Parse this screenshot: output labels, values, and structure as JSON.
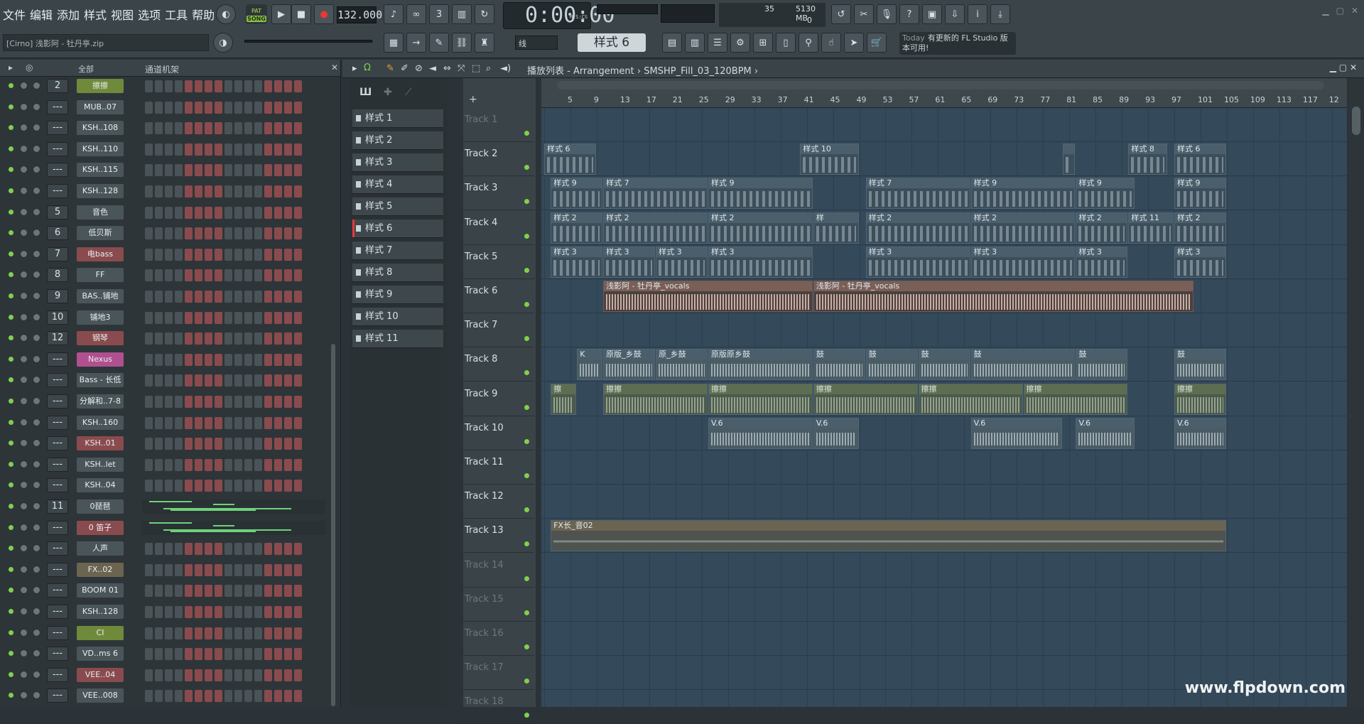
{
  "menu": [
    "文件",
    "编辑",
    "添加",
    "样式",
    "视图",
    "选项",
    "工具",
    "帮助"
  ],
  "transport": {
    "mode_top": "PAT",
    "mode_label": "SONG",
    "tempo": "132.000",
    "time": "0:00:00",
    "time_unit": "M:S:CS"
  },
  "cpu": {
    "value": "35",
    "memory": "5130 MB",
    "poly": "0"
  },
  "project": "[Cirno] 浅影阿 - 牡丹亭.zip",
  "toolbar2": {
    "mode": "线",
    "pattern": "样式 6",
    "news_day": "Today",
    "news_text": "有更新的 FL Studio 版本可用!"
  },
  "rack": {
    "filter": "全部",
    "title": "通道机架"
  },
  "channels": [
    {
      "num": "2",
      "name": "擦擦",
      "color": "#6f8a3a",
      "type": "steps"
    },
    {
      "num": "---",
      "name": "MUB..07",
      "color": "#4a555a",
      "type": "steps"
    },
    {
      "num": "---",
      "name": "KSH..108",
      "color": "#4a555a",
      "type": "steps"
    },
    {
      "num": "---",
      "name": "KSH..110",
      "color": "#4a555a",
      "type": "steps"
    },
    {
      "num": "---",
      "name": "KSH..115",
      "color": "#4a555a",
      "type": "steps"
    },
    {
      "num": "---",
      "name": "KSH..128",
      "color": "#4a555a",
      "type": "steps"
    },
    {
      "num": "5",
      "name": "音色",
      "color": "#4a555a",
      "type": "steps"
    },
    {
      "num": "6",
      "name": "低贝斯",
      "color": "#4a555a",
      "type": "steps"
    },
    {
      "num": "7",
      "name": "电bass",
      "color": "#8a4b4e",
      "type": "steps"
    },
    {
      "num": "8",
      "name": "FF",
      "color": "#4a555a",
      "type": "steps"
    },
    {
      "num": "9",
      "name": "BAS..铺地",
      "color": "#4a555a",
      "type": "steps"
    },
    {
      "num": "10",
      "name": "铺地3",
      "color": "#4a555a",
      "type": "steps"
    },
    {
      "num": "12",
      "name": "钢琴",
      "color": "#8a4b4e",
      "type": "steps"
    },
    {
      "num": "---",
      "name": "Nexus",
      "color": "#b0508f",
      "type": "steps"
    },
    {
      "num": "---",
      "name": "Bass - 长低",
      "color": "#4a555a",
      "type": "steps"
    },
    {
      "num": "---",
      "name": "分解和..7-8",
      "color": "#4a555a",
      "type": "steps"
    },
    {
      "num": "---",
      "name": "KSH..160",
      "color": "#4a555a",
      "type": "steps"
    },
    {
      "num": "---",
      "name": "KSH..01",
      "color": "#8a4b4e",
      "type": "steps"
    },
    {
      "num": "---",
      "name": "KSH..let",
      "color": "#4a555a",
      "type": "steps"
    },
    {
      "num": "---",
      "name": "KSH..04",
      "color": "#4a555a",
      "type": "steps"
    },
    {
      "num": "11",
      "name": "0琵琶",
      "color": "#4a555a",
      "type": "graph"
    },
    {
      "num": "---",
      "name": "0 笛子",
      "color": "#8a4b4e",
      "type": "graph"
    },
    {
      "num": "---",
      "name": "人声",
      "color": "#4a555a",
      "type": "steps"
    },
    {
      "num": "---",
      "name": "FX..02",
      "color": "#6b6450",
      "type": "steps"
    },
    {
      "num": "---",
      "name": "BOOM 01",
      "color": "#4a555a",
      "type": "steps"
    },
    {
      "num": "---",
      "name": "KSH..128",
      "color": "#4a555a",
      "type": "steps"
    },
    {
      "num": "---",
      "name": "CI",
      "color": "#6f8a3a",
      "type": "steps"
    },
    {
      "num": "---",
      "name": "VD..ms 6",
      "color": "#4a555a",
      "type": "steps"
    },
    {
      "num": "---",
      "name": "VEE..04",
      "color": "#8a4b4e",
      "type": "steps"
    },
    {
      "num": "---",
      "name": "VEE..008",
      "color": "#4a555a",
      "type": "steps"
    }
  ],
  "patterns": [
    "样式 1",
    "样式 2",
    "样式 3",
    "样式 4",
    "样式 5",
    "样式 6",
    "样式 7",
    "样式 8",
    "样式 9",
    "样式 10",
    "样式 11"
  ],
  "playlist": {
    "title": "播放列表 - Arrangement",
    "sample": "SMSHP_Fill_03_120BPM"
  },
  "ruler": [
    "5",
    "9",
    "13",
    "17",
    "21",
    "25",
    "29",
    "33",
    "37",
    "41",
    "45",
    "49",
    "53",
    "57",
    "61",
    "65",
    "69",
    "73",
    "77",
    "81",
    "85",
    "89",
    "93",
    "97",
    "101",
    "105",
    "109",
    "113",
    "117",
    "12"
  ],
  "tracks": [
    "Track 1",
    "Track 2",
    "Track 3",
    "Track 4",
    "Track 5",
    "Track 6",
    "Track 7",
    "Track 8",
    "Track 9",
    "Track 10",
    "Track 11",
    "Track 12",
    "Track 13",
    "Track 14",
    "Track 15",
    "Track 16",
    "Track 17",
    "Track 18"
  ],
  "clips": [
    {
      "t": 1,
      "b": 0,
      "w": 8,
      "label": "样式 6",
      "kind": "pat"
    },
    {
      "t": 1,
      "b": 39,
      "w": 9,
      "label": "样式 10",
      "kind": "pat"
    },
    {
      "t": 1,
      "b": 79,
      "w": 2,
      "label": "",
      "kind": "pat"
    },
    {
      "t": 1,
      "b": 89,
      "w": 6,
      "label": "样式 8",
      "kind": "pat"
    },
    {
      "t": 1,
      "b": 96,
      "w": 8,
      "label": "样式 6",
      "kind": "pat"
    },
    {
      "t": 2,
      "b": 1,
      "w": 8,
      "label": "样式 9",
      "kind": "pat"
    },
    {
      "t": 2,
      "b": 9,
      "w": 16,
      "label": "样式 7",
      "kind": "pat"
    },
    {
      "t": 2,
      "b": 25,
      "w": 16,
      "label": "样式 9",
      "kind": "pat"
    },
    {
      "t": 2,
      "b": 49,
      "w": 16,
      "label": "样式 7",
      "kind": "pat"
    },
    {
      "t": 2,
      "b": 65,
      "w": 16,
      "label": "样式 9",
      "kind": "pat"
    },
    {
      "t": 2,
      "b": 81,
      "w": 9,
      "label": "样式 9",
      "kind": "pat"
    },
    {
      "t": 2,
      "b": 96,
      "w": 8,
      "label": "样式 9",
      "kind": "pat"
    },
    {
      "t": 3,
      "b": 1,
      "w": 8,
      "label": "样式 2",
      "kind": "pat"
    },
    {
      "t": 3,
      "b": 9,
      "w": 16,
      "label": "样式 2",
      "kind": "pat"
    },
    {
      "t": 3,
      "b": 25,
      "w": 16,
      "label": "样式 2",
      "kind": "pat"
    },
    {
      "t": 3,
      "b": 41,
      "w": 7,
      "label": "样",
      "kind": "pat"
    },
    {
      "t": 3,
      "b": 49,
      "w": 16,
      "label": "样式 2",
      "kind": "pat"
    },
    {
      "t": 3,
      "b": 65,
      "w": 16,
      "label": "样式 2",
      "kind": "pat"
    },
    {
      "t": 3,
      "b": 81,
      "w": 8,
      "label": "样式 2",
      "kind": "pat"
    },
    {
      "t": 3,
      "b": 89,
      "w": 7,
      "label": "样式 11",
      "kind": "pat"
    },
    {
      "t": 3,
      "b": 96,
      "w": 8,
      "label": "样式 2",
      "kind": "pat"
    },
    {
      "t": 4,
      "b": 1,
      "w": 8,
      "label": "样式 3",
      "kind": "pat"
    },
    {
      "t": 4,
      "b": 9,
      "w": 8,
      "label": "样式 3",
      "kind": "pat"
    },
    {
      "t": 4,
      "b": 17,
      "w": 8,
      "label": "样式 3",
      "kind": "pat"
    },
    {
      "t": 4,
      "b": 25,
      "w": 16,
      "label": "样式 3",
      "kind": "pat"
    },
    {
      "t": 4,
      "b": 49,
      "w": 16,
      "label": "样式 3",
      "kind": "pat"
    },
    {
      "t": 4,
      "b": 65,
      "w": 16,
      "label": "样式 3",
      "kind": "pat"
    },
    {
      "t": 4,
      "b": 81,
      "w": 8,
      "label": "样式 3",
      "kind": "pat"
    },
    {
      "t": 4,
      "b": 96,
      "w": 8,
      "label": "样式 3",
      "kind": "pat"
    },
    {
      "t": 5,
      "b": 9,
      "w": 32,
      "label": "浅影阿 - 牡丹亭_vocals",
      "kind": "vocal"
    },
    {
      "t": 5,
      "b": 41,
      "w": 58,
      "label": "浅影阿 - 牡丹亭_vocals",
      "kind": "vocal"
    },
    {
      "t": 7,
      "b": 5,
      "w": 4,
      "label": "K",
      "kind": "audio"
    },
    {
      "t": 7,
      "b": 9,
      "w": 8,
      "label": "原版_乡鼓",
      "kind": "audio"
    },
    {
      "t": 7,
      "b": 17,
      "w": 8,
      "label": "原_乡鼓",
      "kind": "audio"
    },
    {
      "t": 7,
      "b": 25,
      "w": 16,
      "label": "原版原乡鼓",
      "kind": "audio"
    },
    {
      "t": 7,
      "b": 41,
      "w": 8,
      "label": "鼓",
      "kind": "audio"
    },
    {
      "t": 7,
      "b": 49,
      "w": 8,
      "label": "鼓",
      "kind": "audio"
    },
    {
      "t": 7,
      "b": 57,
      "w": 8,
      "label": "鼓",
      "kind": "audio"
    },
    {
      "t": 7,
      "b": 65,
      "w": 16,
      "label": "鼓",
      "kind": "audio"
    },
    {
      "t": 7,
      "b": 81,
      "w": 8,
      "label": "鼓",
      "kind": "audio"
    },
    {
      "t": 7,
      "b": 96,
      "w": 8,
      "label": "鼓",
      "kind": "audio"
    },
    {
      "t": 8,
      "b": 1,
      "w": 4,
      "label": "擦",
      "kind": "green"
    },
    {
      "t": 8,
      "b": 9,
      "w": 16,
      "label": "擦擦",
      "kind": "green"
    },
    {
      "t": 8,
      "b": 25,
      "w": 16,
      "label": "擦擦",
      "kind": "green"
    },
    {
      "t": 8,
      "b": 41,
      "w": 16,
      "label": "擦擦",
      "kind": "green"
    },
    {
      "t": 8,
      "b": 57,
      "w": 16,
      "label": "擦擦",
      "kind": "green"
    },
    {
      "t": 8,
      "b": 73,
      "w": 16,
      "label": "擦擦",
      "kind": "green"
    },
    {
      "t": 8,
      "b": 96,
      "w": 8,
      "label": "擦擦",
      "kind": "green"
    },
    {
      "t": 9,
      "b": 25,
      "w": 16,
      "label": "V.6",
      "kind": "audio"
    },
    {
      "t": 9,
      "b": 41,
      "w": 7,
      "label": "V.6",
      "kind": "audio"
    },
    {
      "t": 9,
      "b": 65,
      "w": 14,
      "label": "V.6",
      "kind": "audio"
    },
    {
      "t": 9,
      "b": 81,
      "w": 9,
      "label": "V.6",
      "kind": "audio"
    },
    {
      "t": 9,
      "b": 96,
      "w": 8,
      "label": "V.6",
      "kind": "audio"
    },
    {
      "t": 12,
      "b": 1,
      "w": 103,
      "label": "FX长_音02",
      "kind": "fx"
    }
  ],
  "watermark": "www.flpdown.com"
}
